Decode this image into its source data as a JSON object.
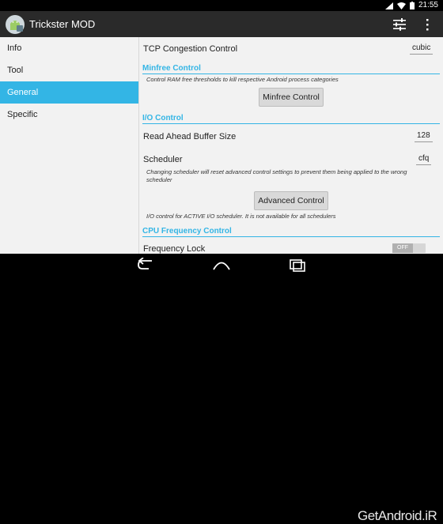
{
  "status_bar": {
    "time": "21:55"
  },
  "action_bar": {
    "title": "Trickster MOD",
    "icons": [
      "android-app-icon",
      "tune-sliders-icon",
      "overflow-menu-icon"
    ]
  },
  "sidebar": {
    "items": [
      {
        "label": "Info",
        "active": false
      },
      {
        "label": "Tool",
        "active": false
      },
      {
        "label": "General",
        "active": true
      },
      {
        "label": "Specific",
        "active": false
      }
    ]
  },
  "main": {
    "tcp": {
      "label": "TCP Congestion Control",
      "value": "cubic"
    },
    "minfree": {
      "title": "Minfree Control",
      "description": "Control RAM free thresholds to kill respective Android process categories",
      "button": "Minfree Control"
    },
    "io": {
      "title": "I/O Control",
      "read_ahead_label": "Read Ahead Buffer Size",
      "read_ahead_value": "128",
      "scheduler_label": "Scheduler",
      "scheduler_value": "cfq",
      "scheduler_note": "Changing scheduler will reset advanced control settings to prevent them being applied to the wrong scheduler",
      "advanced_button": "Advanced Control",
      "advanced_note": "I/O control for ACTIVE I/O scheduler. It is not available for all schedulers"
    },
    "cpu": {
      "title": "CPU Frequency Control",
      "freq_lock_label": "Frequency Lock",
      "freq_lock_state": "OFF"
    }
  },
  "watermark": "GetAndroid.iR",
  "colors": {
    "accent": "#33b5e5",
    "action_bar": "#2a2a2a",
    "background": "#f2f2f2"
  }
}
